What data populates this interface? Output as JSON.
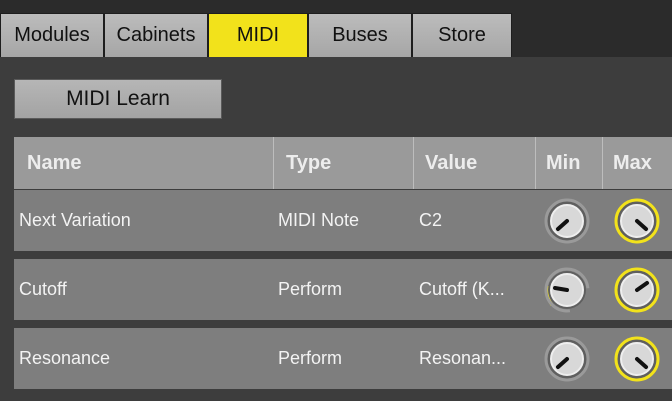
{
  "tabs": [
    {
      "label": "Modules",
      "active": false
    },
    {
      "label": "Cabinets",
      "active": false
    },
    {
      "label": "MIDI",
      "active": true
    },
    {
      "label": "Buses",
      "active": false
    },
    {
      "label": "Store",
      "active": false
    }
  ],
  "toolbar": {
    "midi_learn_label": "MIDI Learn"
  },
  "table": {
    "headers": [
      "Name",
      "Type",
      "Value",
      "Min",
      "Max"
    ],
    "rows": [
      {
        "name": "Next Variation",
        "type": "MIDI Note",
        "value": "C2"
      },
      {
        "name": "Cutoff",
        "type": "Perform",
        "value": "Cutoff (K..."
      },
      {
        "name": "Resonance",
        "type": "Perform",
        "value": "Resonan..."
      }
    ]
  },
  "colors": {
    "accent": "#f2e21b",
    "header_bg": "#9a9a9a",
    "row_bg": "#7e7e7e"
  }
}
